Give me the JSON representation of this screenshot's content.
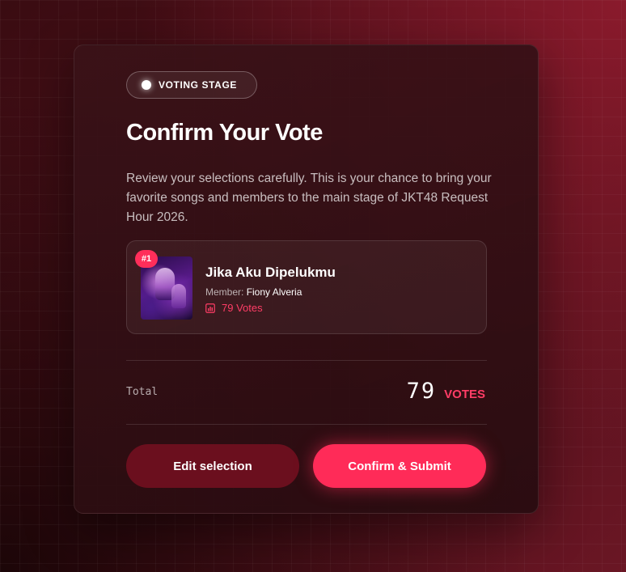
{
  "badge": {
    "label": "VOTING STAGE"
  },
  "title": "Confirm Your Vote",
  "description": "Review your selections carefully. This is your chance to bring your favorite songs and members to the main stage of JKT48 Request Hour 2026.",
  "selection": {
    "rank": "#1",
    "song_title": "Jika Aku Dipelukmu",
    "member_label": "Member:",
    "member_name": "Fiony Alveria",
    "votes_text": "79 Votes"
  },
  "total": {
    "label": "Total",
    "value": "79",
    "unit": "VOTES"
  },
  "buttons": {
    "edit_label": "Edit selection",
    "confirm_label": "Confirm & Submit"
  },
  "colors": {
    "accent": "#ff2b58",
    "edit_button": "#6b0f1e"
  },
  "icons": {
    "badge": "status-dot-icon",
    "votes": "bar-chart-icon"
  }
}
